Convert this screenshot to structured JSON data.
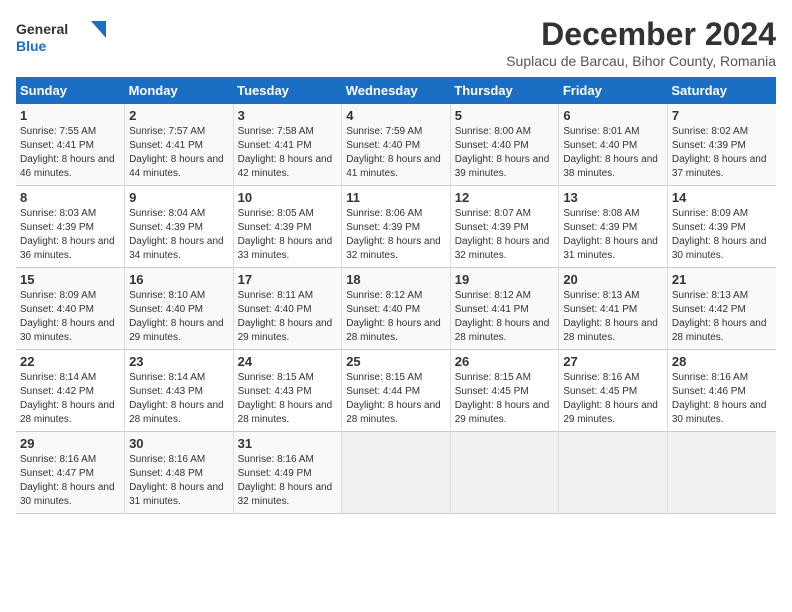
{
  "logo": {
    "text_general": "General",
    "text_blue": "Blue"
  },
  "header": {
    "month": "December 2024",
    "location": "Suplacu de Barcau, Bihor County, Romania"
  },
  "weekdays": [
    "Sunday",
    "Monday",
    "Tuesday",
    "Wednesday",
    "Thursday",
    "Friday",
    "Saturday"
  ],
  "weeks": [
    [
      {
        "day": "1",
        "sunrise": "Sunrise: 7:55 AM",
        "sunset": "Sunset: 4:41 PM",
        "daylight": "Daylight: 8 hours and 46 minutes."
      },
      {
        "day": "2",
        "sunrise": "Sunrise: 7:57 AM",
        "sunset": "Sunset: 4:41 PM",
        "daylight": "Daylight: 8 hours and 44 minutes."
      },
      {
        "day": "3",
        "sunrise": "Sunrise: 7:58 AM",
        "sunset": "Sunset: 4:41 PM",
        "daylight": "Daylight: 8 hours and 42 minutes."
      },
      {
        "day": "4",
        "sunrise": "Sunrise: 7:59 AM",
        "sunset": "Sunset: 4:40 PM",
        "daylight": "Daylight: 8 hours and 41 minutes."
      },
      {
        "day": "5",
        "sunrise": "Sunrise: 8:00 AM",
        "sunset": "Sunset: 4:40 PM",
        "daylight": "Daylight: 8 hours and 39 minutes."
      },
      {
        "day": "6",
        "sunrise": "Sunrise: 8:01 AM",
        "sunset": "Sunset: 4:40 PM",
        "daylight": "Daylight: 8 hours and 38 minutes."
      },
      {
        "day": "7",
        "sunrise": "Sunrise: 8:02 AM",
        "sunset": "Sunset: 4:39 PM",
        "daylight": "Daylight: 8 hours and 37 minutes."
      }
    ],
    [
      {
        "day": "8",
        "sunrise": "Sunrise: 8:03 AM",
        "sunset": "Sunset: 4:39 PM",
        "daylight": "Daylight: 8 hours and 36 minutes."
      },
      {
        "day": "9",
        "sunrise": "Sunrise: 8:04 AM",
        "sunset": "Sunset: 4:39 PM",
        "daylight": "Daylight: 8 hours and 34 minutes."
      },
      {
        "day": "10",
        "sunrise": "Sunrise: 8:05 AM",
        "sunset": "Sunset: 4:39 PM",
        "daylight": "Daylight: 8 hours and 33 minutes."
      },
      {
        "day": "11",
        "sunrise": "Sunrise: 8:06 AM",
        "sunset": "Sunset: 4:39 PM",
        "daylight": "Daylight: 8 hours and 32 minutes."
      },
      {
        "day": "12",
        "sunrise": "Sunrise: 8:07 AM",
        "sunset": "Sunset: 4:39 PM",
        "daylight": "Daylight: 8 hours and 32 minutes."
      },
      {
        "day": "13",
        "sunrise": "Sunrise: 8:08 AM",
        "sunset": "Sunset: 4:39 PM",
        "daylight": "Daylight: 8 hours and 31 minutes."
      },
      {
        "day": "14",
        "sunrise": "Sunrise: 8:09 AM",
        "sunset": "Sunset: 4:39 PM",
        "daylight": "Daylight: 8 hours and 30 minutes."
      }
    ],
    [
      {
        "day": "15",
        "sunrise": "Sunrise: 8:09 AM",
        "sunset": "Sunset: 4:40 PM",
        "daylight": "Daylight: 8 hours and 30 minutes."
      },
      {
        "day": "16",
        "sunrise": "Sunrise: 8:10 AM",
        "sunset": "Sunset: 4:40 PM",
        "daylight": "Daylight: 8 hours and 29 minutes."
      },
      {
        "day": "17",
        "sunrise": "Sunrise: 8:11 AM",
        "sunset": "Sunset: 4:40 PM",
        "daylight": "Daylight: 8 hours and 29 minutes."
      },
      {
        "day": "18",
        "sunrise": "Sunrise: 8:12 AM",
        "sunset": "Sunset: 4:40 PM",
        "daylight": "Daylight: 8 hours and 28 minutes."
      },
      {
        "day": "19",
        "sunrise": "Sunrise: 8:12 AM",
        "sunset": "Sunset: 4:41 PM",
        "daylight": "Daylight: 8 hours and 28 minutes."
      },
      {
        "day": "20",
        "sunrise": "Sunrise: 8:13 AM",
        "sunset": "Sunset: 4:41 PM",
        "daylight": "Daylight: 8 hours and 28 minutes."
      },
      {
        "day": "21",
        "sunrise": "Sunrise: 8:13 AM",
        "sunset": "Sunset: 4:42 PM",
        "daylight": "Daylight: 8 hours and 28 minutes."
      }
    ],
    [
      {
        "day": "22",
        "sunrise": "Sunrise: 8:14 AM",
        "sunset": "Sunset: 4:42 PM",
        "daylight": "Daylight: 8 hours and 28 minutes."
      },
      {
        "day": "23",
        "sunrise": "Sunrise: 8:14 AM",
        "sunset": "Sunset: 4:43 PM",
        "daylight": "Daylight: 8 hours and 28 minutes."
      },
      {
        "day": "24",
        "sunrise": "Sunrise: 8:15 AM",
        "sunset": "Sunset: 4:43 PM",
        "daylight": "Daylight: 8 hours and 28 minutes."
      },
      {
        "day": "25",
        "sunrise": "Sunrise: 8:15 AM",
        "sunset": "Sunset: 4:44 PM",
        "daylight": "Daylight: 8 hours and 28 minutes."
      },
      {
        "day": "26",
        "sunrise": "Sunrise: 8:15 AM",
        "sunset": "Sunset: 4:45 PM",
        "daylight": "Daylight: 8 hours and 29 minutes."
      },
      {
        "day": "27",
        "sunrise": "Sunrise: 8:16 AM",
        "sunset": "Sunset: 4:45 PM",
        "daylight": "Daylight: 8 hours and 29 minutes."
      },
      {
        "day": "28",
        "sunrise": "Sunrise: 8:16 AM",
        "sunset": "Sunset: 4:46 PM",
        "daylight": "Daylight: 8 hours and 30 minutes."
      }
    ],
    [
      {
        "day": "29",
        "sunrise": "Sunrise: 8:16 AM",
        "sunset": "Sunset: 4:47 PM",
        "daylight": "Daylight: 8 hours and 30 minutes."
      },
      {
        "day": "30",
        "sunrise": "Sunrise: 8:16 AM",
        "sunset": "Sunset: 4:48 PM",
        "daylight": "Daylight: 8 hours and 31 minutes."
      },
      {
        "day": "31",
        "sunrise": "Sunrise: 8:16 AM",
        "sunset": "Sunset: 4:49 PM",
        "daylight": "Daylight: 8 hours and 32 minutes."
      },
      null,
      null,
      null,
      null
    ]
  ]
}
